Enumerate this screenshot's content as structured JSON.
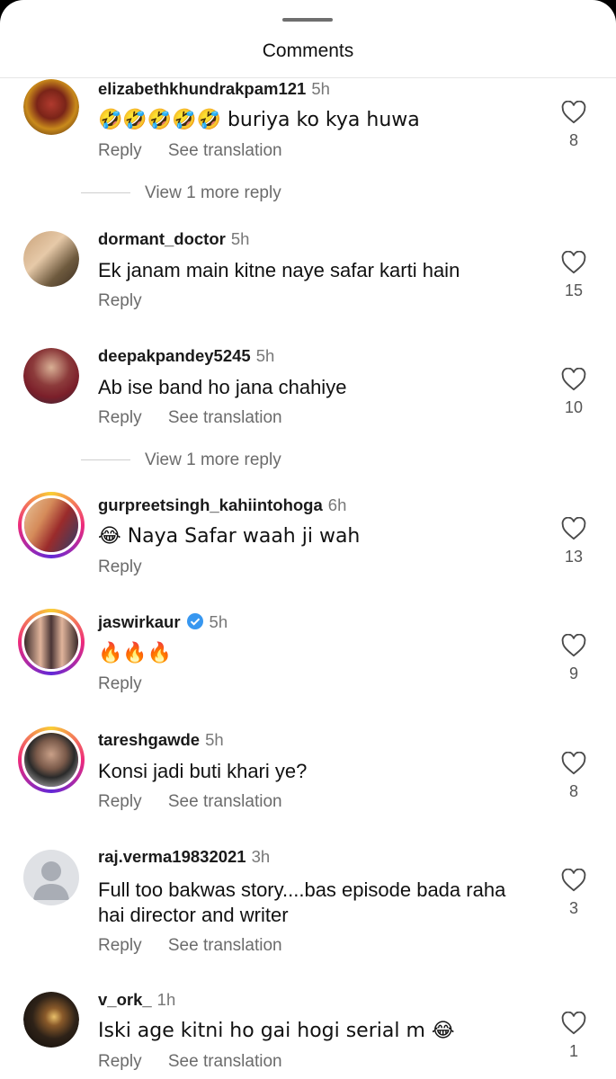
{
  "header": {
    "title": "Comments"
  },
  "actions": {
    "reply": "Reply",
    "see_translation": "See translation"
  },
  "view_more": "View 1 more reply",
  "comments": [
    {
      "username": "elizabethkhundrakpam121",
      "time": "5h",
      "text": "🤣🤣🤣🤣🤣 buriya ko kya huwa",
      "likes": "8"
    },
    {
      "username": "dormant_doctor",
      "time": "5h",
      "text": "Ek janam main kitne naye safar karti hain",
      "likes": "15"
    },
    {
      "username": "deepakpandey5245",
      "time": "5h",
      "text": "Ab ise band ho jana chahiye",
      "likes": "10"
    },
    {
      "username": "gurpreetsingh_kahiintohoga",
      "time": "6h",
      "text": "😂 Naya Safar  waah ji wah",
      "likes": "13"
    },
    {
      "username": "jaswirkaur",
      "time": "5h",
      "text": "🔥🔥🔥",
      "likes": "9"
    },
    {
      "username": "tareshgawde",
      "time": "5h",
      "text": "Konsi jadi buti khari ye?",
      "likes": "8"
    },
    {
      "username": "raj.verma19832021",
      "time": "3h",
      "text": "Full too bakwas story....bas episode bada raha hai director and writer",
      "likes": "3"
    },
    {
      "username": "v_ork_",
      "time": "1h",
      "text": "Iski age kitni ho gai hogi serial m 😂",
      "likes": "1"
    }
  ]
}
